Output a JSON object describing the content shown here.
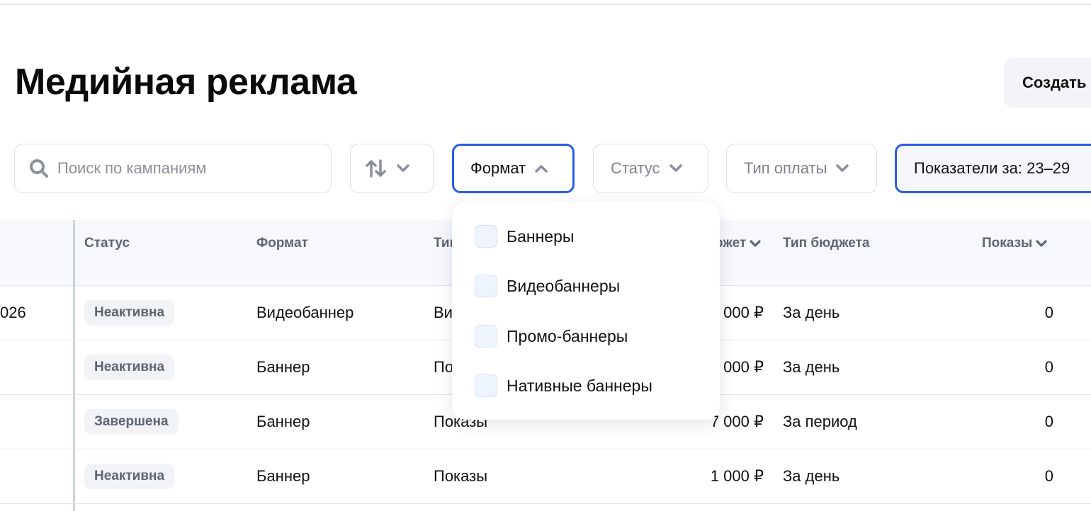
{
  "page_title": "Медийная реклама",
  "create_button": "Создать",
  "search": {
    "placeholder": "Поиск по кампаниям"
  },
  "filters": {
    "format": "Формат",
    "status": "Статус",
    "payment_type": "Тип оплаты",
    "period": "Показатели за: 23–29"
  },
  "table": {
    "headers": {
      "status": "Статус",
      "format": "Формат",
      "type": "Тип",
      "budget": "ожет",
      "budget_type": "Тип бюджета",
      "impressions": "Показы"
    },
    "rows": [
      {
        "date_fragment": "026",
        "status": "Неактивна",
        "format": "Видеобаннер",
        "type": "Ви",
        "budget": "000 ₽",
        "budget_type": "За день",
        "impressions": "0"
      },
      {
        "date_fragment": "",
        "status": "Неактивна",
        "format": "Баннер",
        "type": "По",
        "budget": "000 ₽",
        "budget_type": "За день",
        "impressions": "0"
      },
      {
        "date_fragment": "",
        "status": "Завершена",
        "format": "Баннер",
        "type": "Показы",
        "budget": "7 000 ₽",
        "budget_type": "За период",
        "impressions": "0"
      },
      {
        "date_fragment": "",
        "status": "Неактивна",
        "format": "Баннер",
        "type": "Показы",
        "budget": "1 000 ₽",
        "budget_type": "За день",
        "impressions": "0"
      }
    ]
  },
  "format_dropdown": {
    "options": [
      "Баннеры",
      "Видеобаннеры",
      "Промо-баннеры",
      "Нативные баннеры"
    ]
  },
  "colors": {
    "accent": "#2b5ce6",
    "muted_text": "#5d6472",
    "header_bg": "#f6f8fc"
  },
  "icons": {
    "search": "search-icon",
    "sort": "sort-arrows-icon",
    "chevron": "chevron-down-icon",
    "chevron_up": "chevron-up-icon"
  }
}
